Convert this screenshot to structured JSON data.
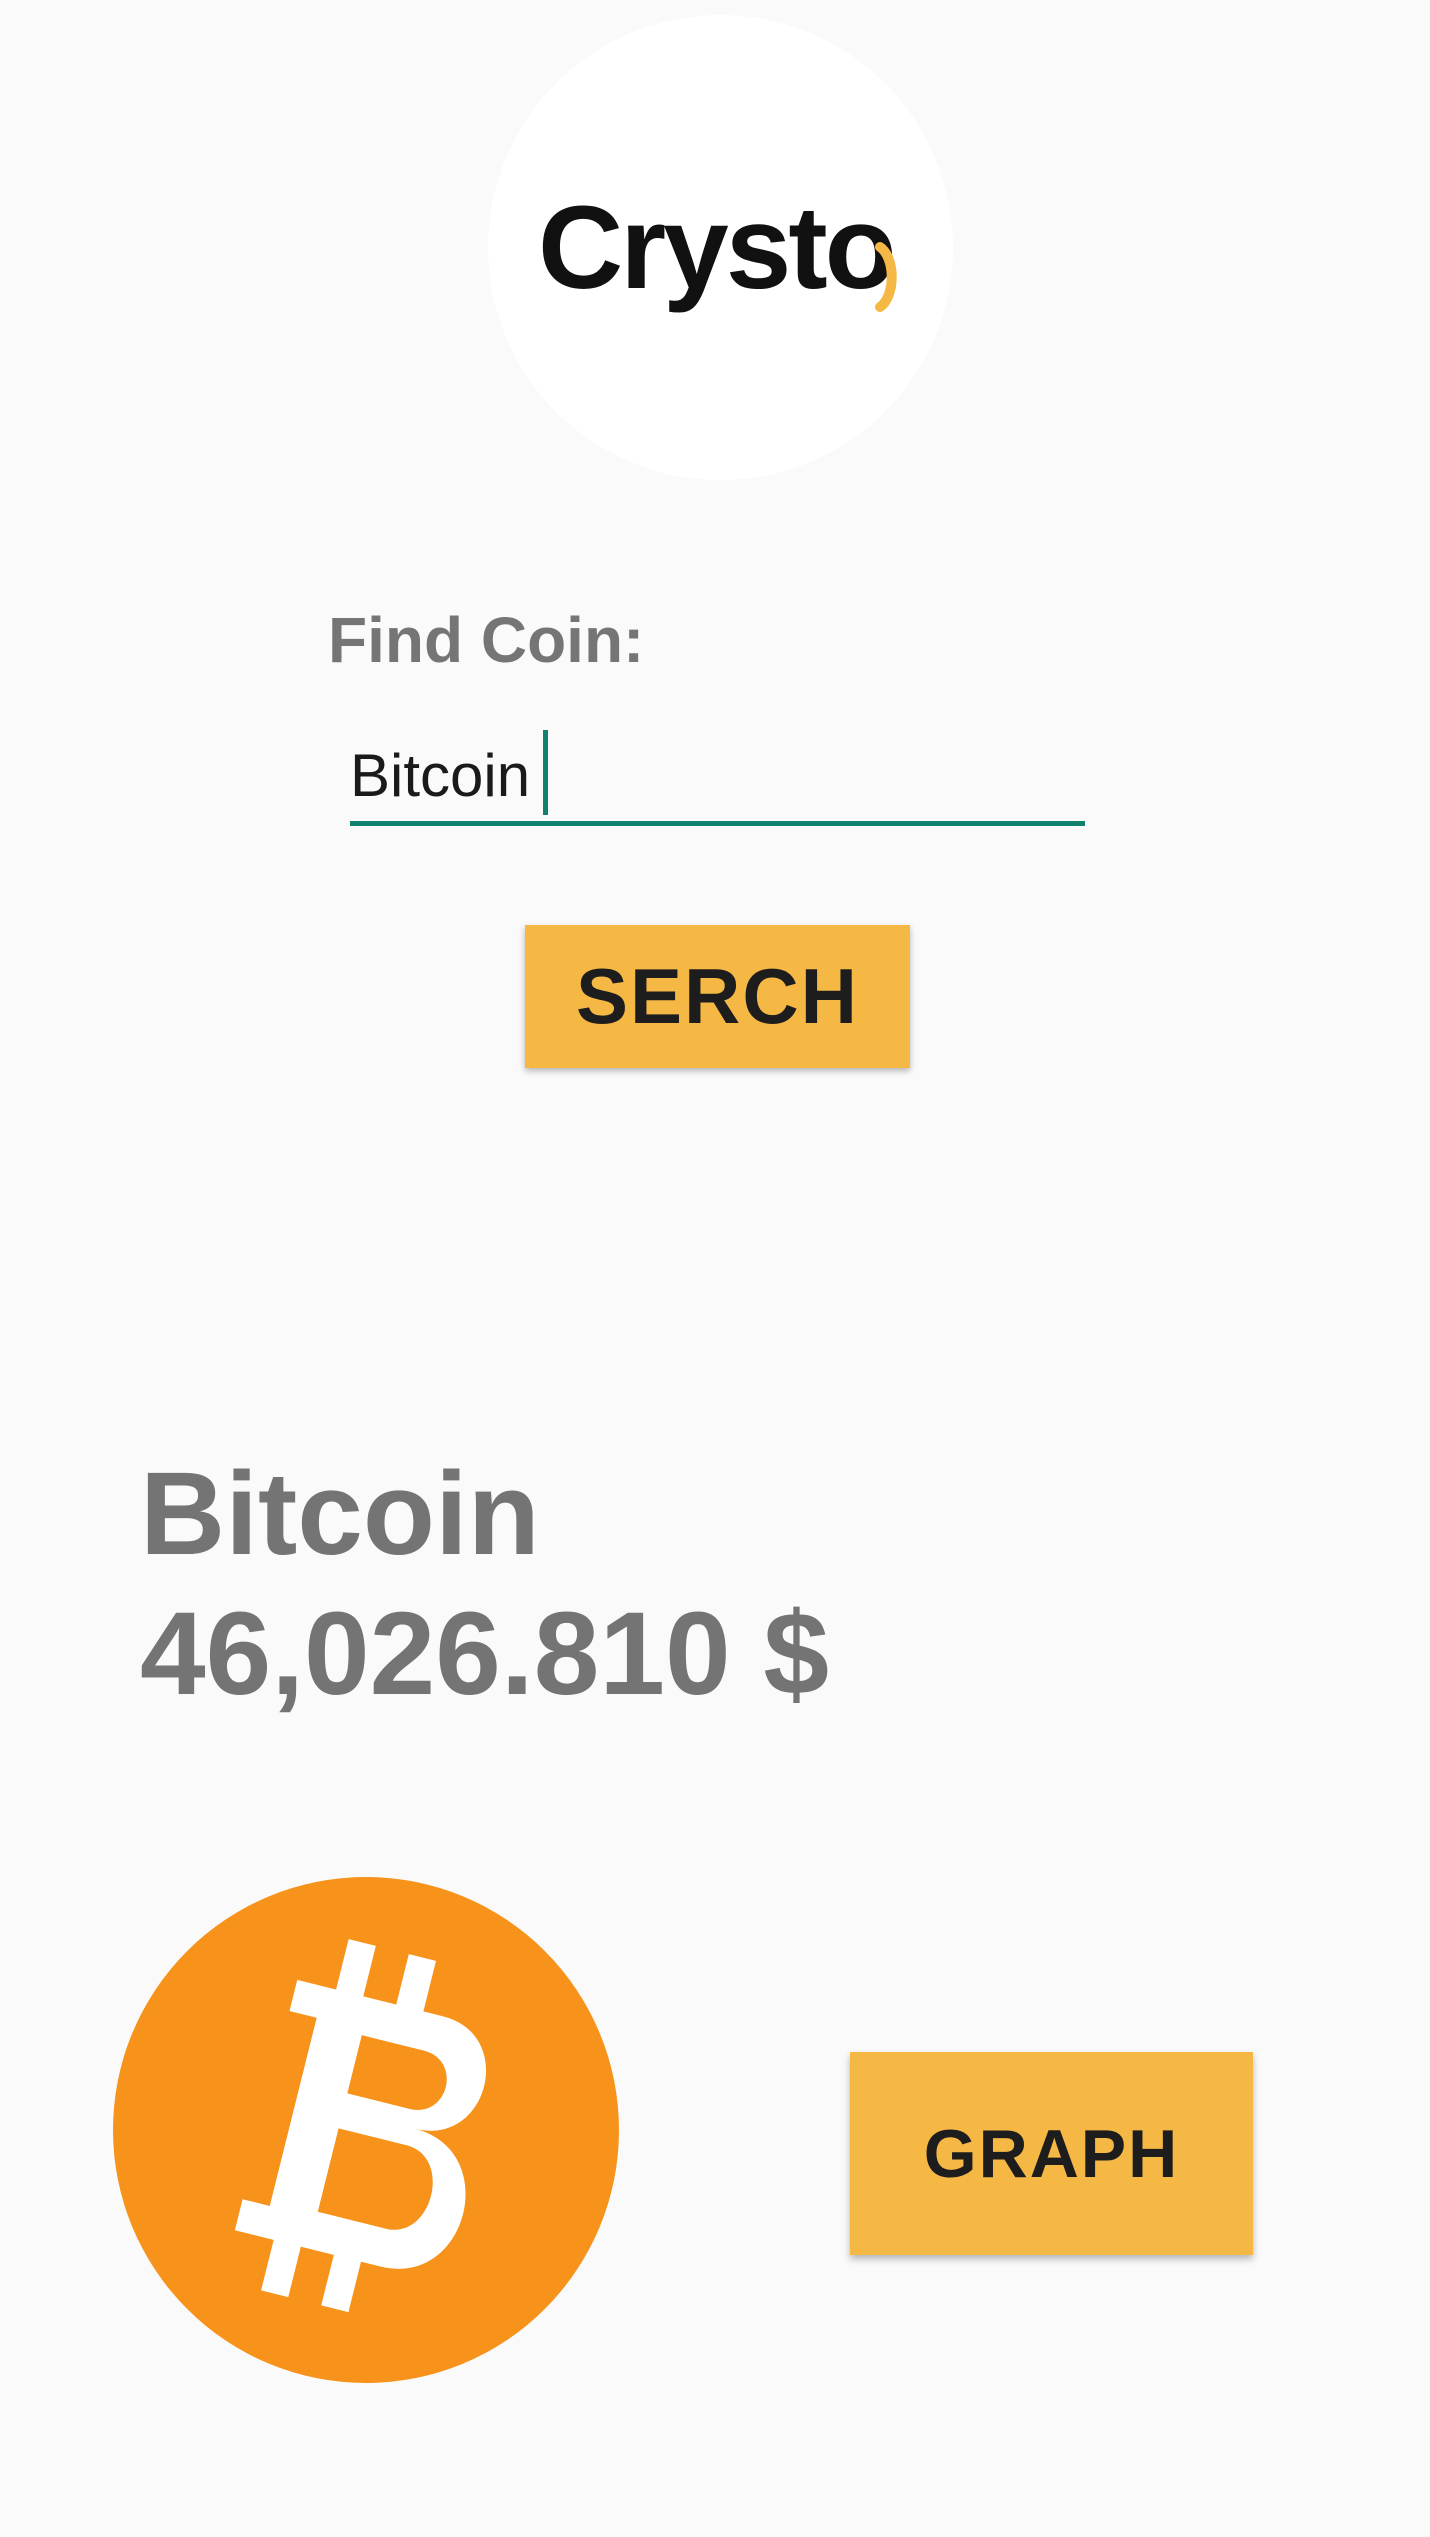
{
  "logo": {
    "text": "Crysto",
    "accent_color": "#f6b844"
  },
  "search": {
    "label": "Find Coin:",
    "value": "Bitcoin",
    "button_label": "SERCH"
  },
  "result": {
    "coin_name": "Bitcoin",
    "price": "46,026.810 $",
    "icon": "bitcoin-icon",
    "icon_color": "#f7931a",
    "graph_button_label": "GRAPH"
  },
  "colors": {
    "button": "#f6b844",
    "input_underline": "#11806f",
    "text_gray": "#757575",
    "background": "#fafafa"
  }
}
